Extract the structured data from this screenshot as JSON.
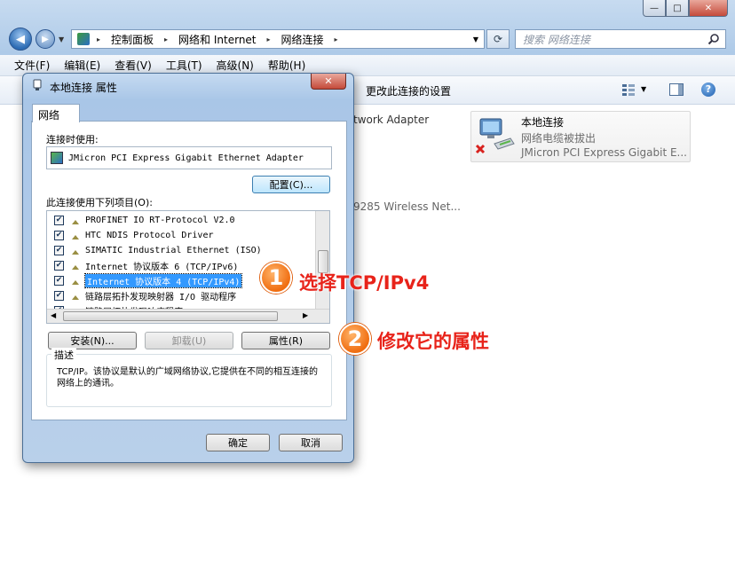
{
  "window": {
    "controls": {
      "minimize": "—",
      "maximize": "□",
      "close": "✕"
    }
  },
  "nav": {
    "back": "◀",
    "forward": "▶"
  },
  "address": {
    "segments": [
      "控制面板",
      "网络和 Internet",
      "网络连接"
    ],
    "separator": "▸"
  },
  "search": {
    "placeholder": "搜索 网络连接",
    "icon": "search-icon"
  },
  "menu": [
    "文件(F)",
    "编辑(E)",
    "查看(V)",
    "工具(T)",
    "高级(N)",
    "帮助(H)"
  ],
  "cmdbar": {
    "link": "更改此连接的设置"
  },
  "content": {
    "left_item_fragment_1": "twork Adapter",
    "left_item_fragment_2": "9285 Wireless Net...",
    "adapter": {
      "name": "本地连接",
      "status": "网络电缆被拔出",
      "device": "JMicron PCI Express Gigabit E..."
    }
  },
  "dialog": {
    "title": "本地连接 属性",
    "close": "✕",
    "tab": "网络",
    "connect_using_label": "连接时使用:",
    "adapter_name": "JMicron PCI Express Gigabit Ethernet Adapter",
    "configure_button": "配置(C)...",
    "items_label": "此连接使用下列项目(O):",
    "items": [
      {
        "label": "PROFINET IO RT-Protocol V2.0",
        "checked": "✔"
      },
      {
        "label": "HTC NDIS Protocol Driver",
        "checked": "✔"
      },
      {
        "label": "SIMATIC Industrial Ethernet (ISO)",
        "checked": "✔"
      },
      {
        "label": "Internet 协议版本 6 (TCP/IPv6)",
        "checked": "✔"
      },
      {
        "label": "Internet 协议版本 4 (TCP/IPv4)",
        "checked": "✔"
      },
      {
        "label": "链路层拓扑发现映射器 I/O 驱动程序",
        "checked": "✔"
      },
      {
        "label": "链路层拓扑发现响应程序",
        "checked": "✔"
      }
    ],
    "install_button": "安装(N)...",
    "uninstall_button": "卸载(U)",
    "properties_button": "属性(R)",
    "description_label": "描述",
    "description": "TCP/IP。该协议是默认的广域网络协议,它提供在不同的相互连接的网络上的通讯。",
    "ok_button": "确定",
    "cancel_button": "取消"
  },
  "annotations": [
    {
      "number": "1",
      "text": "选择TCP/IPv4"
    },
    {
      "number": "2",
      "text": "修改它的属性"
    }
  ],
  "colors": {
    "annotation_text": "#e8231a",
    "annotation_badge": "#f06d10",
    "selection": "#3399ff"
  }
}
